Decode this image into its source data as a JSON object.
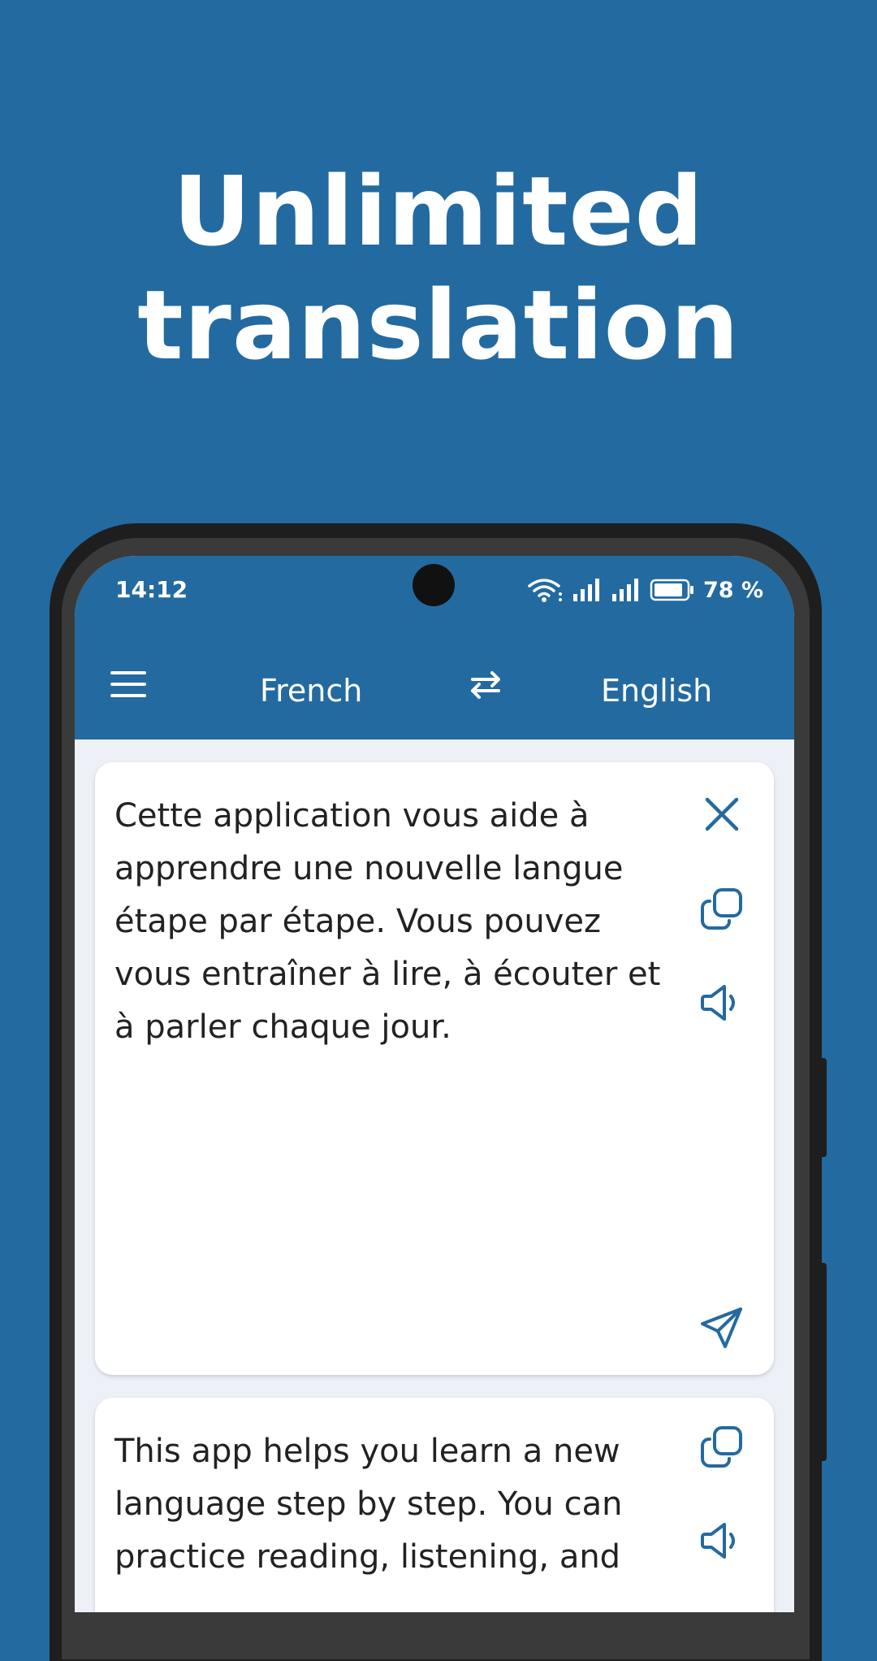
{
  "headline": {
    "line1": "Unlimited",
    "line2": "translation"
  },
  "status_bar": {
    "time": "14:12",
    "battery": "78 %"
  },
  "toolbar": {
    "menu_icon": "hamburger-menu-icon",
    "source_language": "French",
    "swap_icon": "swap-arrows-icon",
    "target_language": "English"
  },
  "source_card": {
    "text": "Cette application vous aide à\napprendre une nouvelle langue\nétape par étape. Vous pouvez\nvous entraîner à lire, à écouter et\nà parler chaque jour.",
    "icons": [
      "close-icon",
      "copy-icon",
      "speaker-icon",
      "send-icon"
    ]
  },
  "target_card": {
    "text": "This app helps you learn a new\nlanguage step by step. You can\npractice reading, listening, and",
    "icons": [
      "copy-icon",
      "speaker-icon"
    ]
  },
  "colors": {
    "brand": "#236aa0",
    "screen_background": "#edf1f7",
    "card": "#ffffff",
    "text": "#222222"
  }
}
